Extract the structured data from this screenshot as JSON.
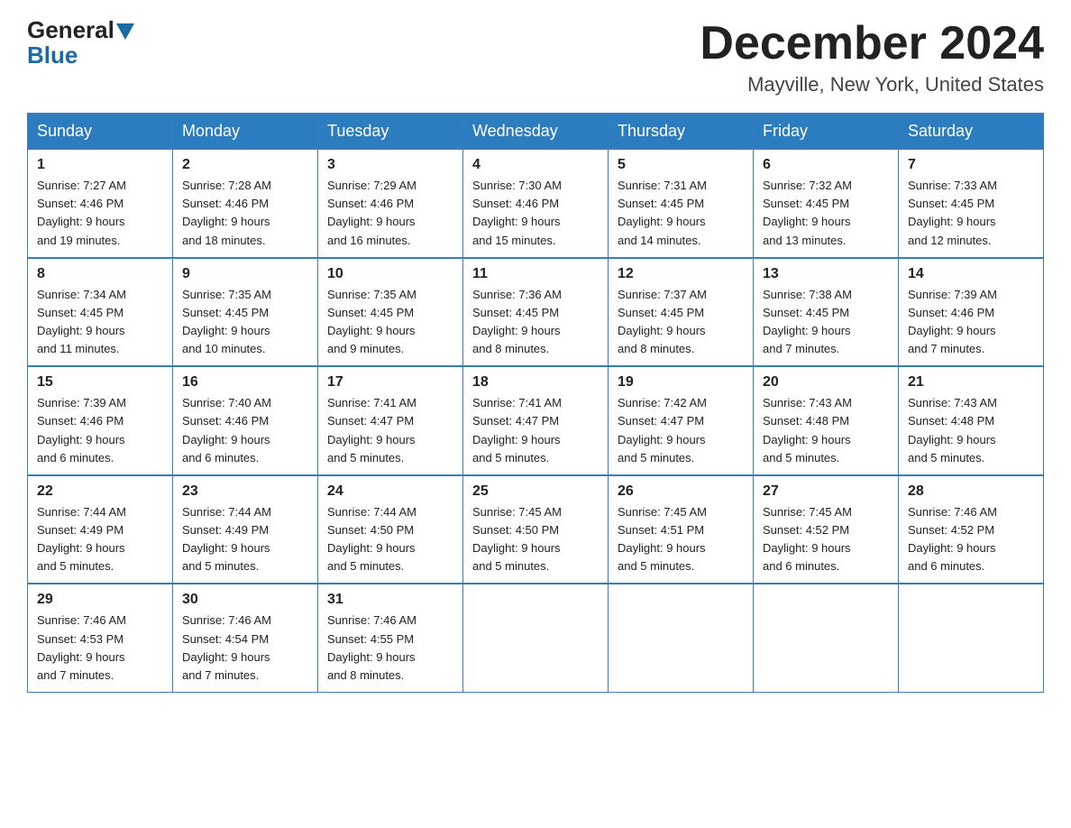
{
  "header": {
    "logo_general": "General",
    "logo_blue": "Blue",
    "month_title": "December 2024",
    "location": "Mayville, New York, United States"
  },
  "days_of_week": [
    "Sunday",
    "Monday",
    "Tuesday",
    "Wednesday",
    "Thursday",
    "Friday",
    "Saturday"
  ],
  "weeks": [
    [
      {
        "day": "1",
        "sunrise": "7:27 AM",
        "sunset": "4:46 PM",
        "daylight": "9 hours and 19 minutes."
      },
      {
        "day": "2",
        "sunrise": "7:28 AM",
        "sunset": "4:46 PM",
        "daylight": "9 hours and 18 minutes."
      },
      {
        "day": "3",
        "sunrise": "7:29 AM",
        "sunset": "4:46 PM",
        "daylight": "9 hours and 16 minutes."
      },
      {
        "day": "4",
        "sunrise": "7:30 AM",
        "sunset": "4:46 PM",
        "daylight": "9 hours and 15 minutes."
      },
      {
        "day": "5",
        "sunrise": "7:31 AM",
        "sunset": "4:45 PM",
        "daylight": "9 hours and 14 minutes."
      },
      {
        "day": "6",
        "sunrise": "7:32 AM",
        "sunset": "4:45 PM",
        "daylight": "9 hours and 13 minutes."
      },
      {
        "day": "7",
        "sunrise": "7:33 AM",
        "sunset": "4:45 PM",
        "daylight": "9 hours and 12 minutes."
      }
    ],
    [
      {
        "day": "8",
        "sunrise": "7:34 AM",
        "sunset": "4:45 PM",
        "daylight": "9 hours and 11 minutes."
      },
      {
        "day": "9",
        "sunrise": "7:35 AM",
        "sunset": "4:45 PM",
        "daylight": "9 hours and 10 minutes."
      },
      {
        "day": "10",
        "sunrise": "7:35 AM",
        "sunset": "4:45 PM",
        "daylight": "9 hours and 9 minutes."
      },
      {
        "day": "11",
        "sunrise": "7:36 AM",
        "sunset": "4:45 PM",
        "daylight": "9 hours and 8 minutes."
      },
      {
        "day": "12",
        "sunrise": "7:37 AM",
        "sunset": "4:45 PM",
        "daylight": "9 hours and 8 minutes."
      },
      {
        "day": "13",
        "sunrise": "7:38 AM",
        "sunset": "4:45 PM",
        "daylight": "9 hours and 7 minutes."
      },
      {
        "day": "14",
        "sunrise": "7:39 AM",
        "sunset": "4:46 PM",
        "daylight": "9 hours and 7 minutes."
      }
    ],
    [
      {
        "day": "15",
        "sunrise": "7:39 AM",
        "sunset": "4:46 PM",
        "daylight": "9 hours and 6 minutes."
      },
      {
        "day": "16",
        "sunrise": "7:40 AM",
        "sunset": "4:46 PM",
        "daylight": "9 hours and 6 minutes."
      },
      {
        "day": "17",
        "sunrise": "7:41 AM",
        "sunset": "4:47 PM",
        "daylight": "9 hours and 5 minutes."
      },
      {
        "day": "18",
        "sunrise": "7:41 AM",
        "sunset": "4:47 PM",
        "daylight": "9 hours and 5 minutes."
      },
      {
        "day": "19",
        "sunrise": "7:42 AM",
        "sunset": "4:47 PM",
        "daylight": "9 hours and 5 minutes."
      },
      {
        "day": "20",
        "sunrise": "7:43 AM",
        "sunset": "4:48 PM",
        "daylight": "9 hours and 5 minutes."
      },
      {
        "day": "21",
        "sunrise": "7:43 AM",
        "sunset": "4:48 PM",
        "daylight": "9 hours and 5 minutes."
      }
    ],
    [
      {
        "day": "22",
        "sunrise": "7:44 AM",
        "sunset": "4:49 PM",
        "daylight": "9 hours and 5 minutes."
      },
      {
        "day": "23",
        "sunrise": "7:44 AM",
        "sunset": "4:49 PM",
        "daylight": "9 hours and 5 minutes."
      },
      {
        "day": "24",
        "sunrise": "7:44 AM",
        "sunset": "4:50 PM",
        "daylight": "9 hours and 5 minutes."
      },
      {
        "day": "25",
        "sunrise": "7:45 AM",
        "sunset": "4:50 PM",
        "daylight": "9 hours and 5 minutes."
      },
      {
        "day": "26",
        "sunrise": "7:45 AM",
        "sunset": "4:51 PM",
        "daylight": "9 hours and 5 minutes."
      },
      {
        "day": "27",
        "sunrise": "7:45 AM",
        "sunset": "4:52 PM",
        "daylight": "9 hours and 6 minutes."
      },
      {
        "day": "28",
        "sunrise": "7:46 AM",
        "sunset": "4:52 PM",
        "daylight": "9 hours and 6 minutes."
      }
    ],
    [
      {
        "day": "29",
        "sunrise": "7:46 AM",
        "sunset": "4:53 PM",
        "daylight": "9 hours and 7 minutes."
      },
      {
        "day": "30",
        "sunrise": "7:46 AM",
        "sunset": "4:54 PM",
        "daylight": "9 hours and 7 minutes."
      },
      {
        "day": "31",
        "sunrise": "7:46 AM",
        "sunset": "4:55 PM",
        "daylight": "9 hours and 8 minutes."
      },
      null,
      null,
      null,
      null
    ]
  ],
  "labels": {
    "sunrise": "Sunrise:",
    "sunset": "Sunset:",
    "daylight": "Daylight:"
  }
}
